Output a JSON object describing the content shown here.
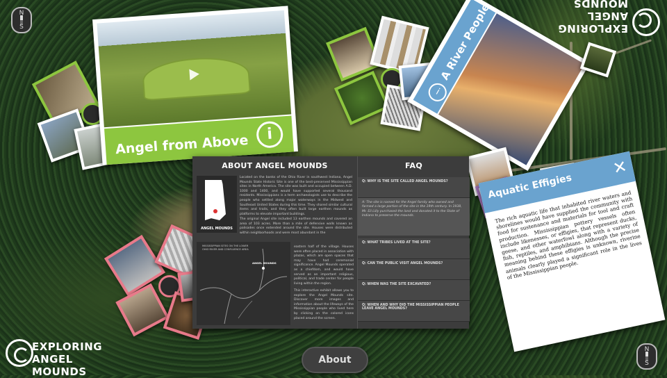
{
  "header_logo": {
    "line1": "EXPLORING",
    "line2": "ANGEL MOUNDS"
  },
  "footer_logo": {
    "line1": "EXPLORING",
    "line2": "ANGEL MOUNDS"
  },
  "compass": {
    "n": "N",
    "s": "S"
  },
  "card_angel_above": {
    "title": "Angel from Above",
    "info_icon": "info-icon",
    "accent": "#8dc63f"
  },
  "card_river_people": {
    "title": "A River People",
    "info_icon": "info-icon",
    "accent": "#6aa3cf"
  },
  "about_panel": {
    "title": "ABOUT ANGEL MOUNDS",
    "map_label": "ANGEL MOUNDS",
    "para1": "Located on the banks of the Ohio River in southwest Indiana, Angel Mounds State Historic Site is one of the best-preserved Mississippian sites in North America. The site was built and occupied between A.D. 1000 and 1400, and would have supported several thousand residents. Mississippians is a term archaeologists use to describe the people who settled along major waterways in the Midwest and Southeast United States during this time. They shared similar cultural items and traits, and they often built large earthen mounds as platforms to elevate important buildings.",
    "para2": "The original Angel site included 13 earthen mounds and covered an area of 103 acres. More than a mile of defensive walls known as palisades once extended around the site. Houses were distributed within neighborhoods and were most abundant in the",
    "para3": "eastern half of the village. Houses were often placed in association with plazas, which are open spaces that may have had ceremonial significance. Angel Mounds operated as a chiefdom, and would have served as an important religious, political, and trade center for people living within the region.",
    "para4": "This interactive exhibit allows you to explore the Angel Mounds site. Discover more images and information about the lifeways of the Mississippian people who lived here by clicking on the colored icons placed around the screen.",
    "river_map_label": "MISSISSIPPIAN SITES ON THE LOWER OHIO RIVER AND CONFLUENCE AREA",
    "river_map_site": "ANGEL MOUNDS"
  },
  "faq": {
    "title": "FAQ",
    "items": [
      {
        "q": "Q: WHY IS THE SITE CALLED ANGEL MOUNDS?",
        "a": "A: The site is named for the Angel family who owned and farmed a large portion of the site in the 19th century. In 1938, Mr. Eli Lilly purchased the land and donated it to the State of Indiana to preserve the mounds."
      },
      {
        "q": "Q: WHAT TRIBES LIVED AT THE SITE?"
      },
      {
        "q": "Q: CAN THE PUBLIC VISIT ANGEL MOUNDS?"
      },
      {
        "q": "Q: WHEN WAS THE SITE EXCAVATED?"
      },
      {
        "q": "Q: WHEN AND WHY DID THE MISSISSIPPIAN PEOPLE LEAVE ANGEL MOUNDS?"
      }
    ]
  },
  "aquatic_effigies": {
    "title": "Aquatic Effigies",
    "close": "✕",
    "body": "The rich aquatic life that inhabited river waters and shorelines would have supplied the community with food for sustenance and materials for tool and craft production. Mississippian pottery vessels often include likenesses, or effigies, that represent ducks, geese, and other waterfowl along with a variety of fish, reptiles, and amphibians. Although the precise meaning behind these effigies is unknown, riverine animals clearly played a significant role in the lives of the Mississippian people."
  },
  "about_button": {
    "label": "About"
  },
  "colors": {
    "green": "#8dc63f",
    "blue": "#6aa3cf",
    "pink": "#e87a8a",
    "purple": "#9b6fb0",
    "panel": "#3c3c3c"
  }
}
